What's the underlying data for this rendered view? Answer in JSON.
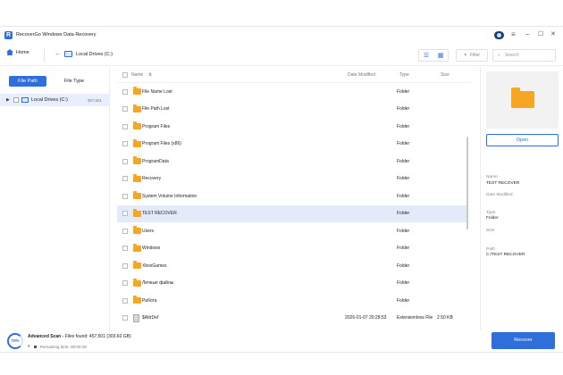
{
  "app": {
    "title": "RecoverGo Windows Data Recovery",
    "logo": "R"
  },
  "window_controls": {
    "menu": "≡",
    "minimize": "−",
    "maximize": "☐",
    "close": "✕"
  },
  "toolbar": {
    "home_label": "Home",
    "back_icon": "←",
    "breadcrumb": "Local Drives (C:)",
    "view_list_icon": "☰",
    "view_grid_icon": "▦",
    "filter_label": "Filter",
    "search_placeholder": "Search"
  },
  "sidebar": {
    "tabs": [
      {
        "label": "File Path",
        "active": true
      },
      {
        "label": "File Type",
        "active": false
      }
    ],
    "tree": [
      {
        "label": "Local Drives (C:)",
        "count": "457,501"
      }
    ]
  },
  "list": {
    "columns": {
      "name": "Name",
      "date": "Date Modified",
      "type": "Type",
      "size": "Size",
      "sort_icon": "⇅"
    },
    "rows": [
      {
        "name": "File Name Lost",
        "date": "",
        "type": "Folder",
        "size": "",
        "kind": "folder"
      },
      {
        "name": "File Path Lost",
        "date": "",
        "type": "Folder",
        "size": "",
        "kind": "folder"
      },
      {
        "name": "Program Files",
        "date": "",
        "type": "Folder",
        "size": "",
        "kind": "folder"
      },
      {
        "name": "Program Files (x86)",
        "date": "",
        "type": "Folder",
        "size": "",
        "kind": "folder"
      },
      {
        "name": "ProgramData",
        "date": "",
        "type": "Folder",
        "size": "",
        "kind": "folder"
      },
      {
        "name": "Recovery",
        "date": "",
        "type": "Folder",
        "size": "",
        "kind": "folder"
      },
      {
        "name": "System Volume Information",
        "date": "",
        "type": "Folder",
        "size": "",
        "kind": "folder"
      },
      {
        "name": "TEST RECOVER",
        "date": "",
        "type": "Folder",
        "size": "",
        "kind": "folder",
        "selected": true
      },
      {
        "name": "Users",
        "date": "",
        "type": "Folder",
        "size": "",
        "kind": "folder"
      },
      {
        "name": "Windows",
        "date": "",
        "type": "Folder",
        "size": "",
        "kind": "folder"
      },
      {
        "name": "XboxGames",
        "date": "",
        "type": "Folder",
        "size": "",
        "kind": "folder"
      },
      {
        "name": "Личные файлы",
        "date": "",
        "type": "Folder",
        "size": "",
        "kind": "folder"
      },
      {
        "name": "Работа",
        "date": "",
        "type": "Folder",
        "size": "",
        "kind": "folder"
      },
      {
        "name": "$AttrDef",
        "date": "2026-01-07 20:28:53",
        "type": "Extensionless File",
        "size": "2.50 KB",
        "kind": "file"
      }
    ]
  },
  "details": {
    "open_label": "Open",
    "name_label": "Name",
    "name_value": "TEST RECOVER",
    "date_label": "Date Modified",
    "type_label": "Type",
    "type_value": "Folder",
    "size_label": "Size",
    "path_label": "Path",
    "path_value": "C:/TEST RECOVER"
  },
  "status": {
    "progress_text": "70%",
    "progress": 0.7,
    "scan_title": "Advanced Scan - ",
    "files_found": "Files found: 457,501 (303.60 GB)",
    "remaining": "Remaining time: 00:03:28"
  },
  "recover_label": "Recover",
  "colors": {
    "accent": "#2f6fdb",
    "folder": "#f5a623",
    "selected_row": "#e3ebfb"
  }
}
